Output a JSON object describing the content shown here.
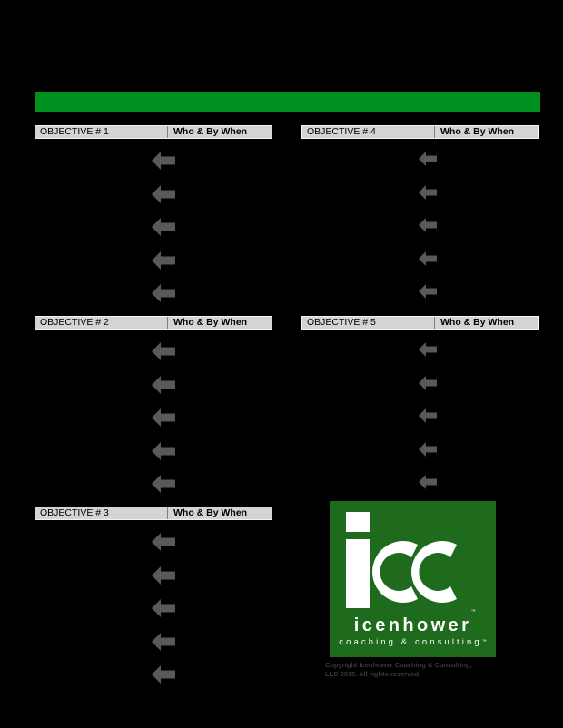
{
  "page": {
    "background_color": "#000000",
    "banner_color": "#00901f",
    "header_cell_color": "#d4d4d4",
    "arrow_color": "#595959",
    "logo_green": "#1e6b1e"
  },
  "banner": {
    "label": ""
  },
  "columns": {
    "header_who_label": "Who & By When"
  },
  "objectives": [
    {
      "title": "OBJECTIVE # 1",
      "who_label": "Who & By When",
      "column": "left",
      "row": 1,
      "arrow_count": 5,
      "arrow_size": "large",
      "rows": [
        "",
        "",
        "",
        "",
        ""
      ],
      "who_values": [
        "",
        "",
        "",
        "",
        ""
      ]
    },
    {
      "title": "OBJECTIVE # 2",
      "who_label": "Who & By When",
      "column": "left",
      "row": 2,
      "arrow_count": 5,
      "arrow_size": "large",
      "rows": [
        "",
        "",
        "",
        "",
        ""
      ],
      "who_values": [
        "",
        "",
        "",
        "",
        ""
      ]
    },
    {
      "title": "OBJECTIVE # 3",
      "who_label": "Who & By When",
      "column": "left",
      "row": 3,
      "arrow_count": 5,
      "arrow_size": "large",
      "rows": [
        "",
        "",
        "",
        "",
        ""
      ],
      "who_values": [
        "",
        "",
        "",
        "",
        ""
      ]
    },
    {
      "title": "OBJECTIVE # 4",
      "who_label": "Who & By When",
      "column": "right",
      "row": 1,
      "arrow_count": 5,
      "arrow_size": "small",
      "rows": [
        "",
        "",
        "",
        "",
        ""
      ],
      "who_values": [
        "",
        "",
        "",
        "",
        ""
      ]
    },
    {
      "title": "OBJECTIVE # 5",
      "who_label": "Who & By When",
      "column": "right",
      "row": 2,
      "arrow_count": 5,
      "arrow_size": "small",
      "rows": [
        "",
        "",
        "",
        "",
        ""
      ],
      "who_values": [
        "",
        "",
        "",
        "",
        ""
      ]
    }
  ],
  "logo": {
    "mark_text": "icc",
    "trademark": "™",
    "wordmark": "icenhower",
    "tagline": "coaching & consulting",
    "tagline_tm": "™",
    "copyright": "Copyright Icenhower Coaching & Consulting,\nLLC 2015. All rights reserved."
  }
}
